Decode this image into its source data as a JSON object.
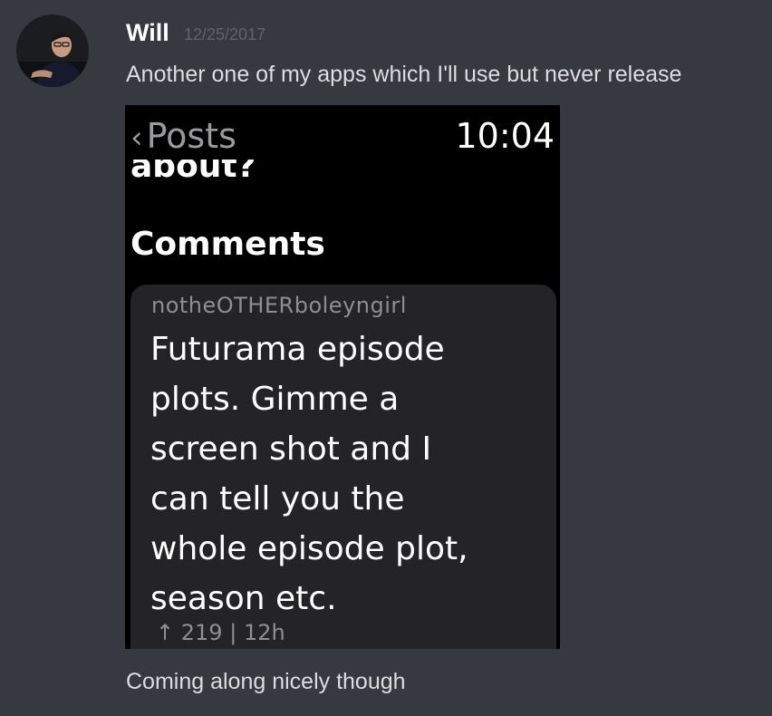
{
  "message": {
    "author": "Will",
    "timestamp": "12/25/2017",
    "text_1": "Another one of my apps which I'll use but never release",
    "text_2": "Coming along nicely though",
    "avatar_icon": "user-avatar-photo"
  },
  "attachment": {
    "back_chevron": "‹",
    "back_label": "Posts",
    "time": "10:04",
    "partial_title": "about?",
    "section_heading": "Comments",
    "comment": {
      "author": "notheOTHERboleyngirl",
      "lines": [
        "Futurama episode",
        "plots. Gimme a",
        "screen shot and I",
        "can tell you the",
        "whole episode plot,",
        "season etc."
      ],
      "upvote_icon": "↑",
      "score": "219",
      "separator": "|",
      "age": "12h"
    }
  },
  "colors": {
    "background": "#36393f",
    "username": "#ffffff",
    "timestamp": "#5f636a",
    "message_text": "#dcddde",
    "watch_background": "#000000",
    "card_background": "#242426",
    "secondary_text": "#8e8e93"
  }
}
